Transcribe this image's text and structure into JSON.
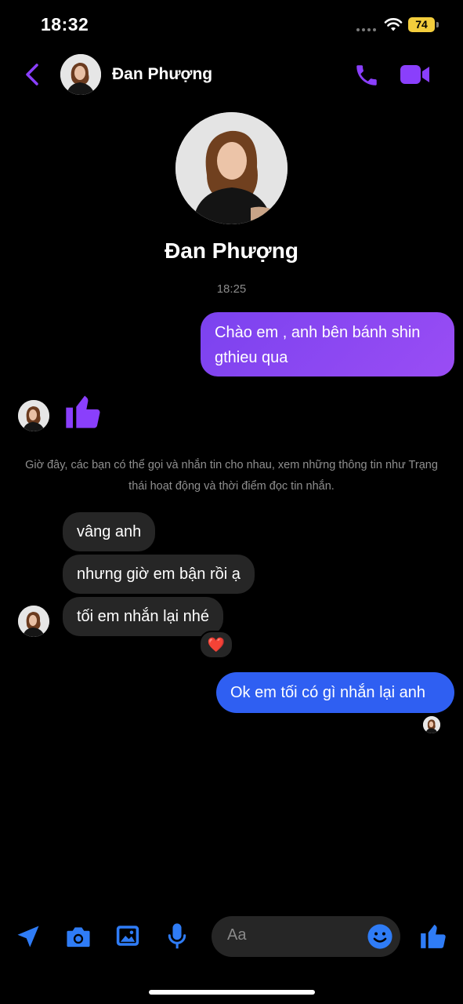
{
  "status_bar": {
    "time": "18:32",
    "battery": "74"
  },
  "header": {
    "contact_name": "Đan Phượng"
  },
  "profile": {
    "name": "Đan Phượng"
  },
  "conversation": {
    "timestamp": "18:25",
    "sent_1": "Chào em , anh bên bánh shin gthieu qua",
    "notice": "Giờ đây, các bạn có thể gọi và nhắn tin cho nhau, xem những thông tin như Trạng thái hoạt động và thời điểm đọc tin nhắn.",
    "received": [
      "vâng anh",
      "nhưng giờ em bận rồi ạ",
      "tối em nhắn lại nhé"
    ],
    "reaction": "❤️",
    "sent_2": "Ok em tối có gì nhắn lại anh"
  },
  "composer": {
    "placeholder": "Aa"
  },
  "colors": {
    "accent_purple": "#8a3ffc",
    "accent_blue": "#2f5ff2",
    "bubble_gray": "#262626"
  }
}
